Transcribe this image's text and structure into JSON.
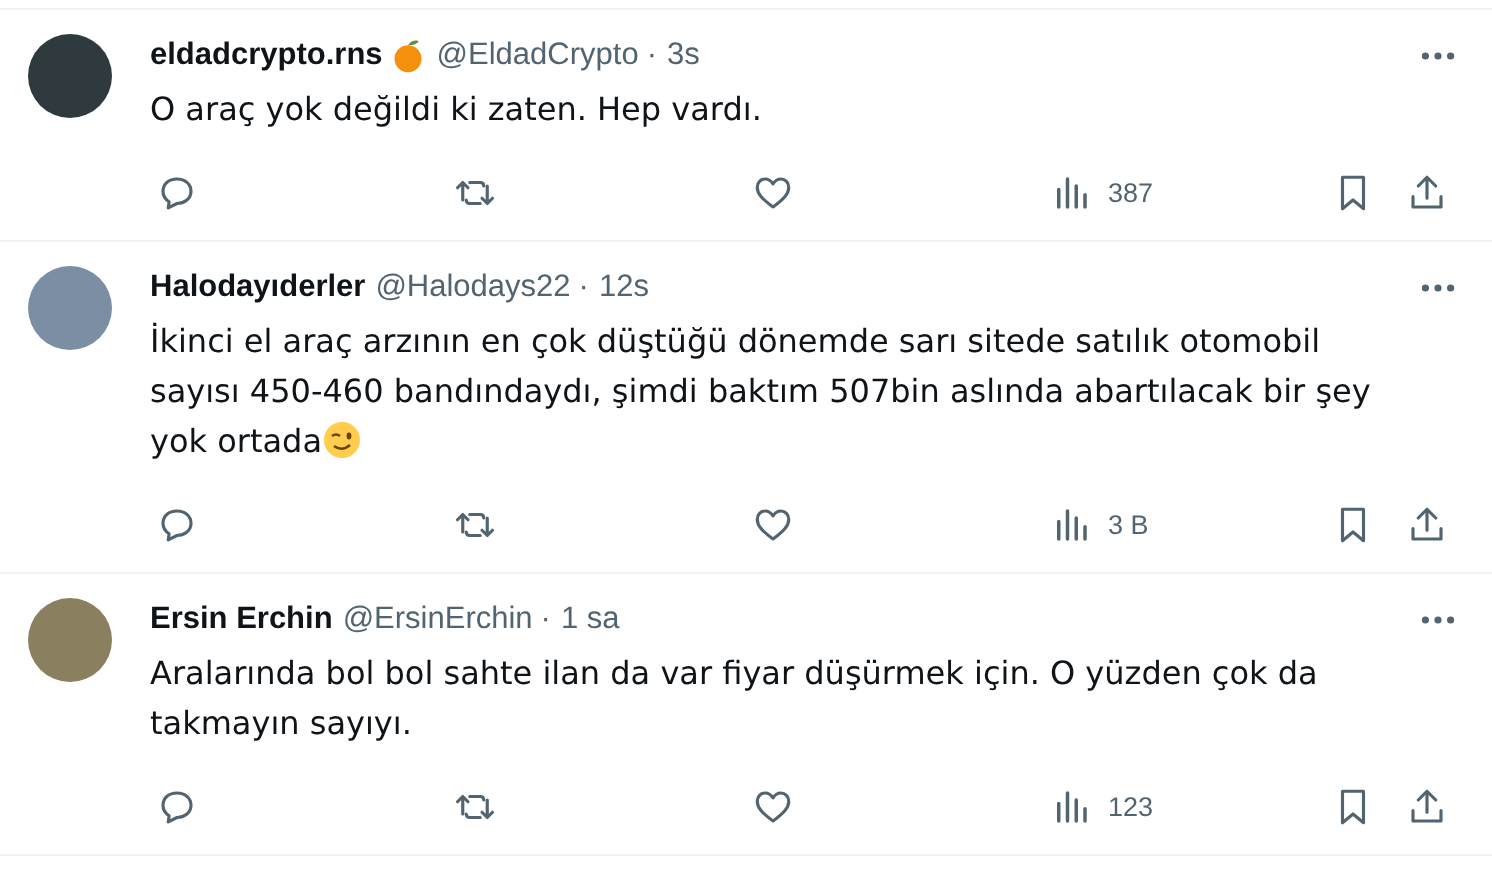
{
  "tweets": [
    {
      "name": "eldadcrypto.rns",
      "has_badge": true,
      "handle": "@EldadCrypto",
      "dot": "·",
      "time": "3s",
      "text": "O araç yok değildi ki zaten. Hep vardı.",
      "ends_with_emoji": false,
      "views": "387"
    },
    {
      "name": "Halodayıderler",
      "has_badge": false,
      "handle": "@Halodays22",
      "dot": "·",
      "time": "12s",
      "text": "İkinci el araç arzının en çok düştüğü dönemde sarı sitede satılık otomobil sayısı 450-460 bandındaydı, şimdi baktım 507bin aslında abartılacak bir şey yok ortada",
      "ends_with_emoji": true,
      "views": "3 B"
    },
    {
      "name": "Ersin Erchin",
      "has_badge": false,
      "handle": "@ErsinErchin",
      "dot": "·",
      "time": "1 sa",
      "text": "Aralarında bol bol sahte ilan da var fiyar düşürmek için. O yüzden çok da takmayın sayıyı.",
      "ends_with_emoji": false,
      "views": "123"
    }
  ]
}
